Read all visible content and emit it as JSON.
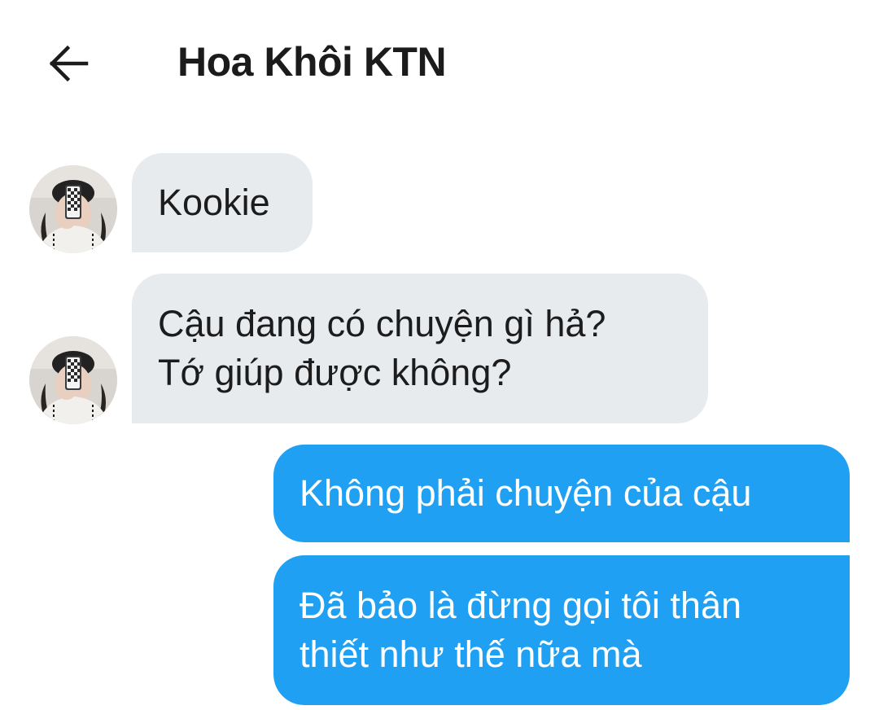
{
  "header": {
    "back_icon": "arrow-left-icon",
    "title": "Hoa Khôi KTN"
  },
  "colors": {
    "incoming_bubble": "#e8ebee",
    "outgoing_bubble": "#1fa0f2",
    "background": "#ffffff",
    "text_dark": "#1c1c1c"
  },
  "messages": [
    {
      "sender": "contact",
      "lines": [
        "Kookie"
      ]
    },
    {
      "sender": "contact",
      "lines": [
        "Cậu đang có chuyện gì hả?",
        "Tớ giúp được không?"
      ]
    },
    {
      "sender": "me",
      "lines": [
        "Không phải chuyện của cậu"
      ]
    },
    {
      "sender": "me",
      "lines": [
        "Đã bảo là đừng gọi tôi thân",
        "thiết như thế nữa mà"
      ]
    }
  ]
}
